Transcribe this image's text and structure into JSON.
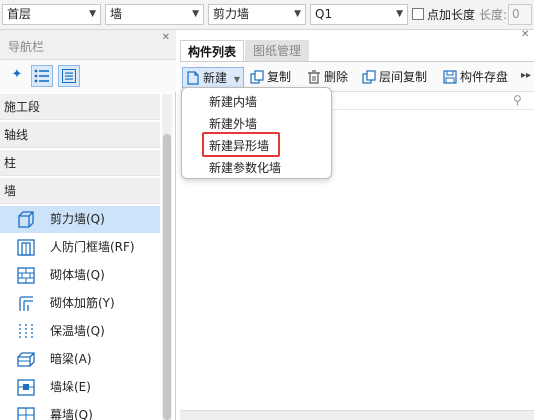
{
  "toolbar": {
    "floor": "首层",
    "category": "墙",
    "type": "剪力墙",
    "component": "Q1",
    "add_length_label": "点加长度",
    "length_label": "长度:",
    "length_value": "0"
  },
  "nav": {
    "title": "导航栏",
    "categories": {
      "construction": "施工段",
      "axis": "轴线",
      "column": "柱",
      "wall": "墙"
    },
    "items": [
      {
        "label": "剪力墙(Q)",
        "icon": "shear-wall-icon",
        "selected": true
      },
      {
        "label": "人防门框墙(RF)",
        "icon": "civil-defense-door-wall-icon",
        "selected": false
      },
      {
        "label": "砌体墙(Q)",
        "icon": "masonry-wall-icon",
        "selected": false
      },
      {
        "label": "砌体加筋(Y)",
        "icon": "masonry-rebar-icon",
        "selected": false
      },
      {
        "label": "保温墙(Q)",
        "icon": "insulation-wall-icon",
        "selected": false
      },
      {
        "label": "暗梁(A)",
        "icon": "hidden-beam-icon",
        "selected": false
      },
      {
        "label": "墙垛(E)",
        "icon": "wall-pier-icon",
        "selected": false
      },
      {
        "label": "幕墙(Q)",
        "icon": "curtain-wall-icon",
        "selected": false
      }
    ]
  },
  "tabs": {
    "component_list": "构件列表",
    "drawing_manage": "图纸管理"
  },
  "actions": {
    "new": "新建",
    "copy": "复制",
    "delete": "删除",
    "floor_copy": "层间复制",
    "save_component": "构件存盘"
  },
  "new_menu": {
    "inner_wall": "新建内墙",
    "outer_wall": "新建外墙",
    "shaped_wall": "新建异形墙",
    "param_wall": "新建参数化墙"
  },
  "colors": {
    "accent": "#1a6fc2",
    "selection": "#cde3fa",
    "highlight_box": "#e53935"
  }
}
